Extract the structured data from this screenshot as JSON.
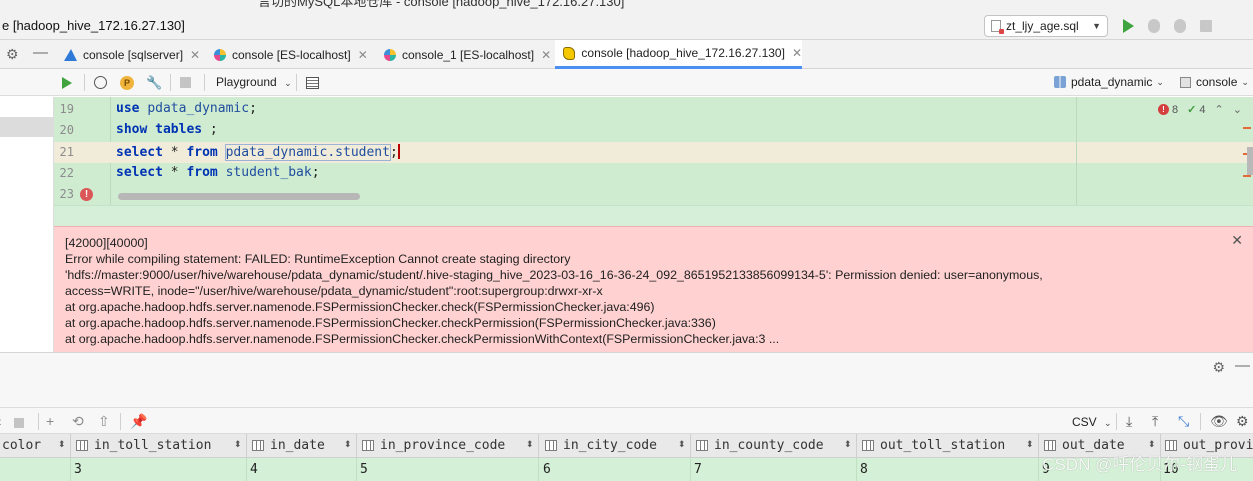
{
  "window": {
    "title": "e [hadoop_hive_172.16.27.130]",
    "overflow_title": "言切的MySQL本地仓库 - console [hadoop_hive_172.16.27.130]"
  },
  "toolbar": {
    "run_config": "zt_ljy_age.sql",
    "run_icon": "play-icon",
    "debug_icon": "bug-icon",
    "stop_icon": "stop-icon"
  },
  "tabs": [
    {
      "label": "console [sqlserver]",
      "icon": "azure-icon",
      "active": false
    },
    {
      "label": "console [ES-localhost]",
      "icon": "elasticsearch-icon",
      "active": false
    },
    {
      "label": "console_1 [ES-localhost]",
      "icon": "elasticsearch-icon",
      "active": false
    },
    {
      "label": "console [hadoop_hive_172.16.27.130]",
      "icon": "hive-icon",
      "active": true
    }
  ],
  "editor_toolbar": {
    "p_badge": "P",
    "playground": "Playground",
    "schema": "pdata_dynamic",
    "session": "console"
  },
  "editor": {
    "lines": [
      {
        "num": "19",
        "tokens": [
          [
            "kw",
            "use"
          ],
          [
            "pl",
            " "
          ],
          [
            "id",
            "pdata_dynamic"
          ],
          [
            "pl",
            ";"
          ]
        ]
      },
      {
        "num": "20",
        "tokens": [
          [
            "kw",
            "show"
          ],
          [
            "pl",
            " "
          ],
          [
            "kw",
            "tables"
          ],
          [
            "pl",
            " ;"
          ]
        ]
      },
      {
        "num": "21",
        "tokens": [
          [
            "kw",
            "select"
          ],
          [
            "pl",
            " * "
          ],
          [
            "kw",
            "from"
          ],
          [
            "pl",
            " "
          ],
          [
            "id",
            "pdata_dynamic.student"
          ],
          [
            "pl",
            ";"
          ]
        ]
      },
      {
        "num": "22",
        "tokens": [
          [
            "kw",
            "select"
          ],
          [
            "pl",
            " * "
          ],
          [
            "kw",
            "from"
          ],
          [
            "pl",
            " "
          ],
          [
            "id",
            "student_bak"
          ],
          [
            "pl",
            ";"
          ]
        ]
      },
      {
        "num": "23",
        "tokens": []
      }
    ],
    "error_marker": "!",
    "errors_count": "8",
    "warnings_count": "4"
  },
  "error": {
    "lines": [
      "[42000][40000]",
      "Error while compiling statement: FAILED: RuntimeException Cannot create staging directory",
      "'hdfs://master:9000/user/hive/warehouse/pdata_dynamic/student/.hive-staging_hive_2023-03-16_16-36-24_092_8651952133856099134-5': Permission denied: user=anonymous,",
      "access=WRITE, inode=\"/user/hive/warehouse/pdata_dynamic/student\":root:supergroup:drwxr-xr-x",
      "at org.apache.hadoop.hdfs.server.namenode.FSPermissionChecker.check(FSPermissionChecker.java:496)",
      "at org.apache.hadoop.hdfs.server.namenode.FSPermissionChecker.checkPermission(FSPermissionChecker.java:336)",
      "at org.apache.hadoop.hdfs.server.namenode.FSPermissionChecker.checkPermissionWithContext(FSPermissionChecker.java:3 ..."
    ]
  },
  "results": {
    "export_format": "CSV",
    "columns": [
      "color",
      "in_toll_station",
      "in_date",
      "in_province_code",
      "in_city_code",
      "in_county_code",
      "out_toll_station",
      "out_date",
      "out_provi"
    ],
    "row": [
      "",
      "3",
      "4",
      "5",
      "6",
      "7",
      "8",
      "9",
      "10"
    ]
  },
  "watermark": "CSDN @呼伦贝尔-钢蛋儿"
}
